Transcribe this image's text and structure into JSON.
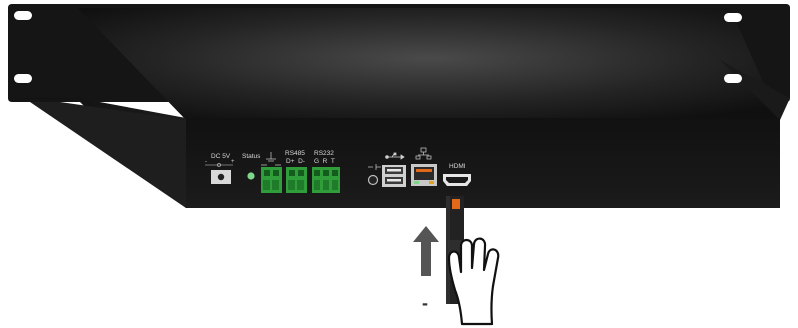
{
  "labels": {
    "dc": "DC 5V",
    "status": "Status",
    "rs485": "RS485",
    "rs485_pins": "D+  D-",
    "rs232": "RS232",
    "rs232_pins": "G  R  T",
    "hdmi": "HDMI",
    "minus": "-"
  },
  "icons": [
    "dc-polarity-icon",
    "ground-icon",
    "usb-icon",
    "network-icon",
    "audio-icon",
    "hand-pointer-icon",
    "up-arrow-icon"
  ],
  "colors": {
    "chassis": "#1a1a1a",
    "terminal_green": "#2f9e3a",
    "led_green": "#7fd68a",
    "arrow": "#555555",
    "hdmi_stick": "#222222",
    "hdmi_stick_accent": "#e06a1a"
  }
}
